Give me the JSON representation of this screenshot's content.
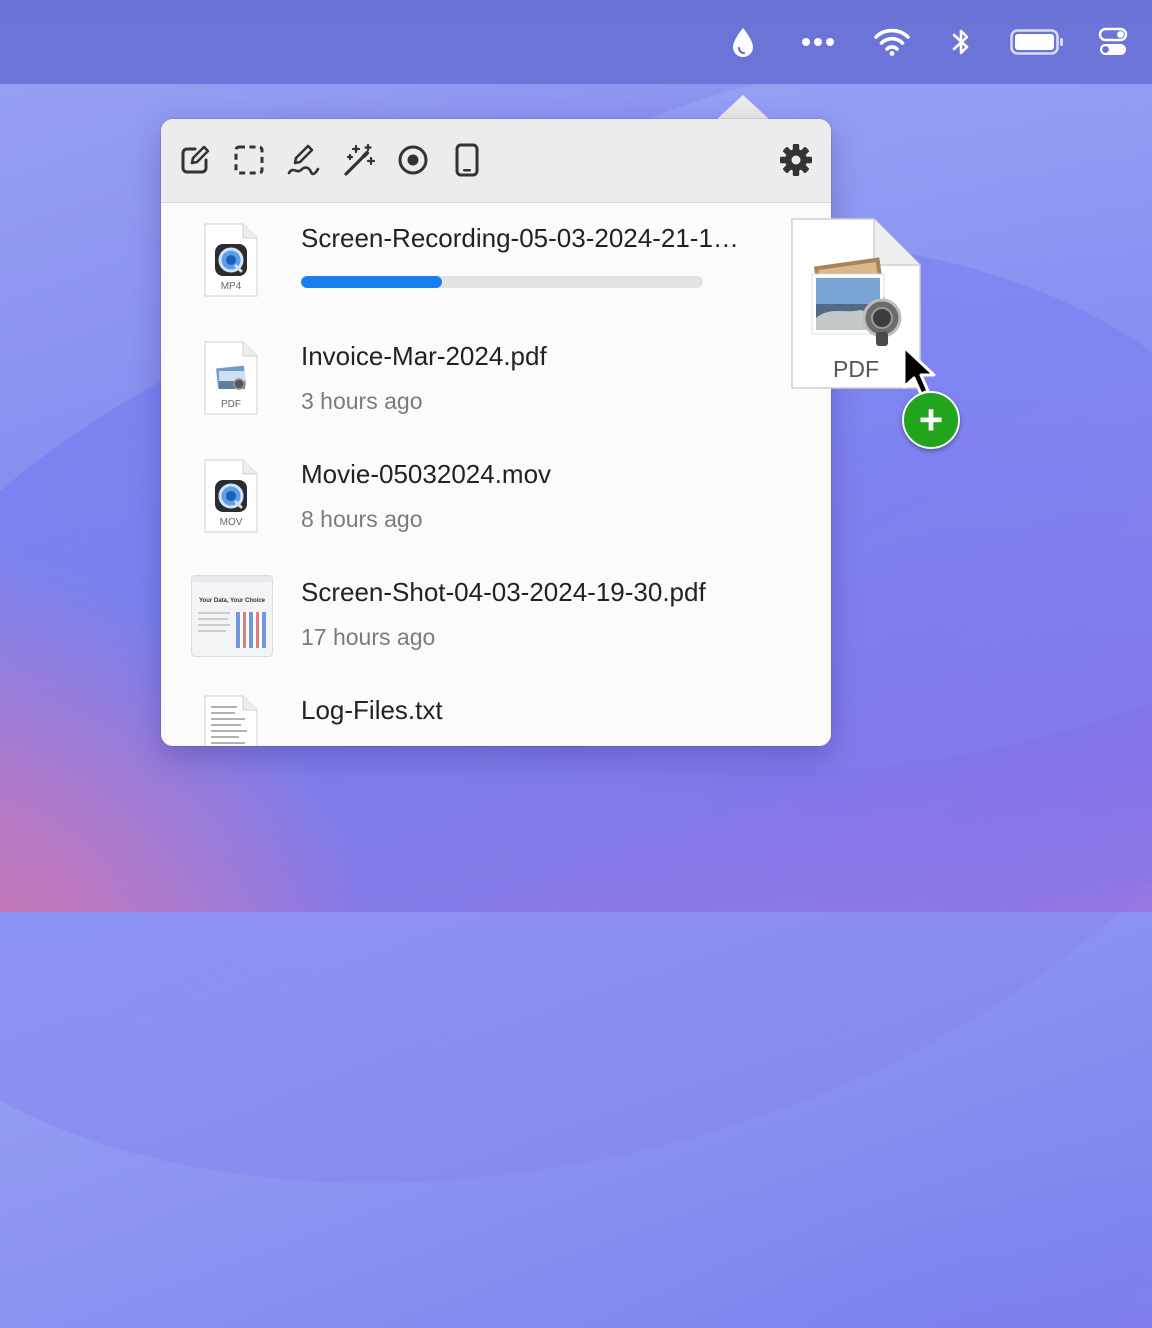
{
  "menubar": {
    "icons": [
      "droplet-icon",
      "ellipsis-icon",
      "wifi-icon",
      "bluetooth-icon",
      "battery-icon",
      "control-center-icon"
    ]
  },
  "toolbar": {
    "buttons": [
      "annotate-icon",
      "capture-area-icon",
      "signature-icon",
      "magic-wand-icon",
      "record-icon",
      "device-icon"
    ],
    "settings_icon": "gear-icon"
  },
  "files": [
    {
      "name": "Screen-Recording-05-03-2024-21-1…",
      "type_label": "MP4",
      "progress": 0.35,
      "time": ""
    },
    {
      "name": "Invoice-Mar-2024.pdf",
      "type_label": "PDF",
      "time": "3 hours ago"
    },
    {
      "name": "Movie-05032024.mov",
      "type_label": "MOV",
      "time": "8 hours ago"
    },
    {
      "name": "Screen-Shot-04-03-2024-19-30.pdf",
      "type_label": "",
      "thumb_title": "Your Data, Your Choice",
      "time": "17 hours ago"
    },
    {
      "name": "Log-Files.txt",
      "type_label": "",
      "time": ""
    }
  ],
  "drag": {
    "label": "PDF",
    "badge": "+"
  },
  "colors": {
    "accent": "#1a7ef0",
    "plus_badge": "#22a51c"
  }
}
